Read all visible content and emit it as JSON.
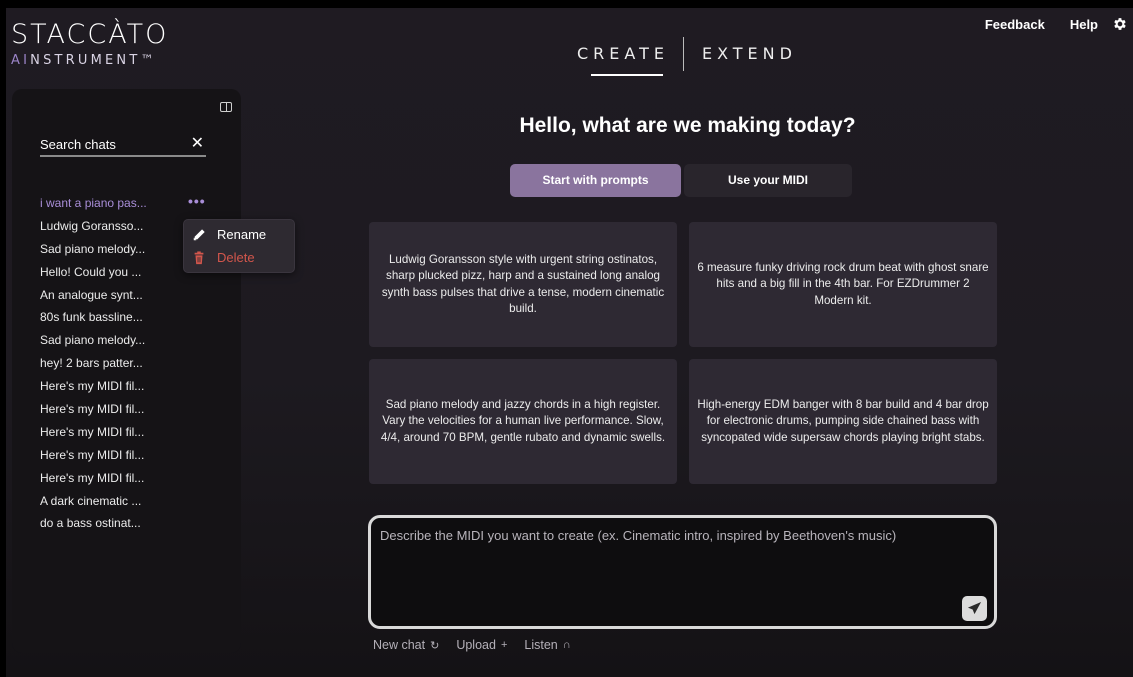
{
  "logo": {
    "main": "STACCÀTO",
    "sub_prefix": "AI",
    "sub_rest": "NSTRUMENT™"
  },
  "header": {
    "tabs": [
      {
        "label": "CREATE",
        "active": true
      },
      {
        "label": "EXTEND",
        "active": false
      }
    ],
    "links": {
      "feedback": "Feedback",
      "help": "Help"
    },
    "icons": [
      "gear-icon"
    ]
  },
  "sidebar": {
    "search": {
      "placeholder": "Search chats",
      "clear_glyph": "✕"
    },
    "more_glyph": "•••",
    "chats": [
      "i want a piano pas...",
      "Ludwig Goransso...",
      "Sad piano melody...",
      "Hello! Could you ...",
      "An analogue synt...",
      "80s funk bassline...",
      "Sad piano melody...",
      "hey! 2 bars patter...",
      "Here's my MIDI fil...",
      "Here's my MIDI fil...",
      "Here's my MIDI fil...",
      "Here's my MIDI fil...",
      "Here's my MIDI fil...",
      "A dark cinematic ...",
      "do a bass ostinat..."
    ],
    "context_menu": {
      "rename": "Rename",
      "delete": "Delete"
    }
  },
  "main": {
    "greeting": "Hello, what are we making today?",
    "modes": {
      "prompts": "Start with prompts",
      "midi": "Use your MIDI"
    },
    "cards": [
      "Ludwig Goransson style with urgent string ostinatos, sharp plucked pizz, harp and a sustained long analog synth bass pulses that drive a tense, modern cinematic build.",
      "6 measure funky driving rock drum beat with ghost snare hits and a big fill in the 4th bar. For EZDrummer 2 Modern kit.",
      "Sad piano melody and jazzy chords in a high register. Vary the velocities for a human live performance. Slow, 4/4, around 70 BPM, gentle rubato and dynamic swells.",
      "High-energy EDM banger with 8 bar build and 4 bar drop for electronic drums, pumping side chained bass with syncopated wide supersaw chords playing bright stabs."
    ],
    "prompt": {
      "placeholder": "Describe the MIDI you want to create (ex. Cinematic intro, inspired by Beethoven's music)",
      "value": ""
    },
    "actions": {
      "new_chat": "New chat",
      "new_chat_glyph": "↻",
      "upload": "Upload",
      "upload_glyph": "+",
      "listen": "Listen",
      "listen_glyph": "∩"
    }
  },
  "colors": {
    "accent": "#8a749e",
    "active_chat": "#a98ed8",
    "delete": "#d2564c",
    "card": "#2e2933"
  }
}
